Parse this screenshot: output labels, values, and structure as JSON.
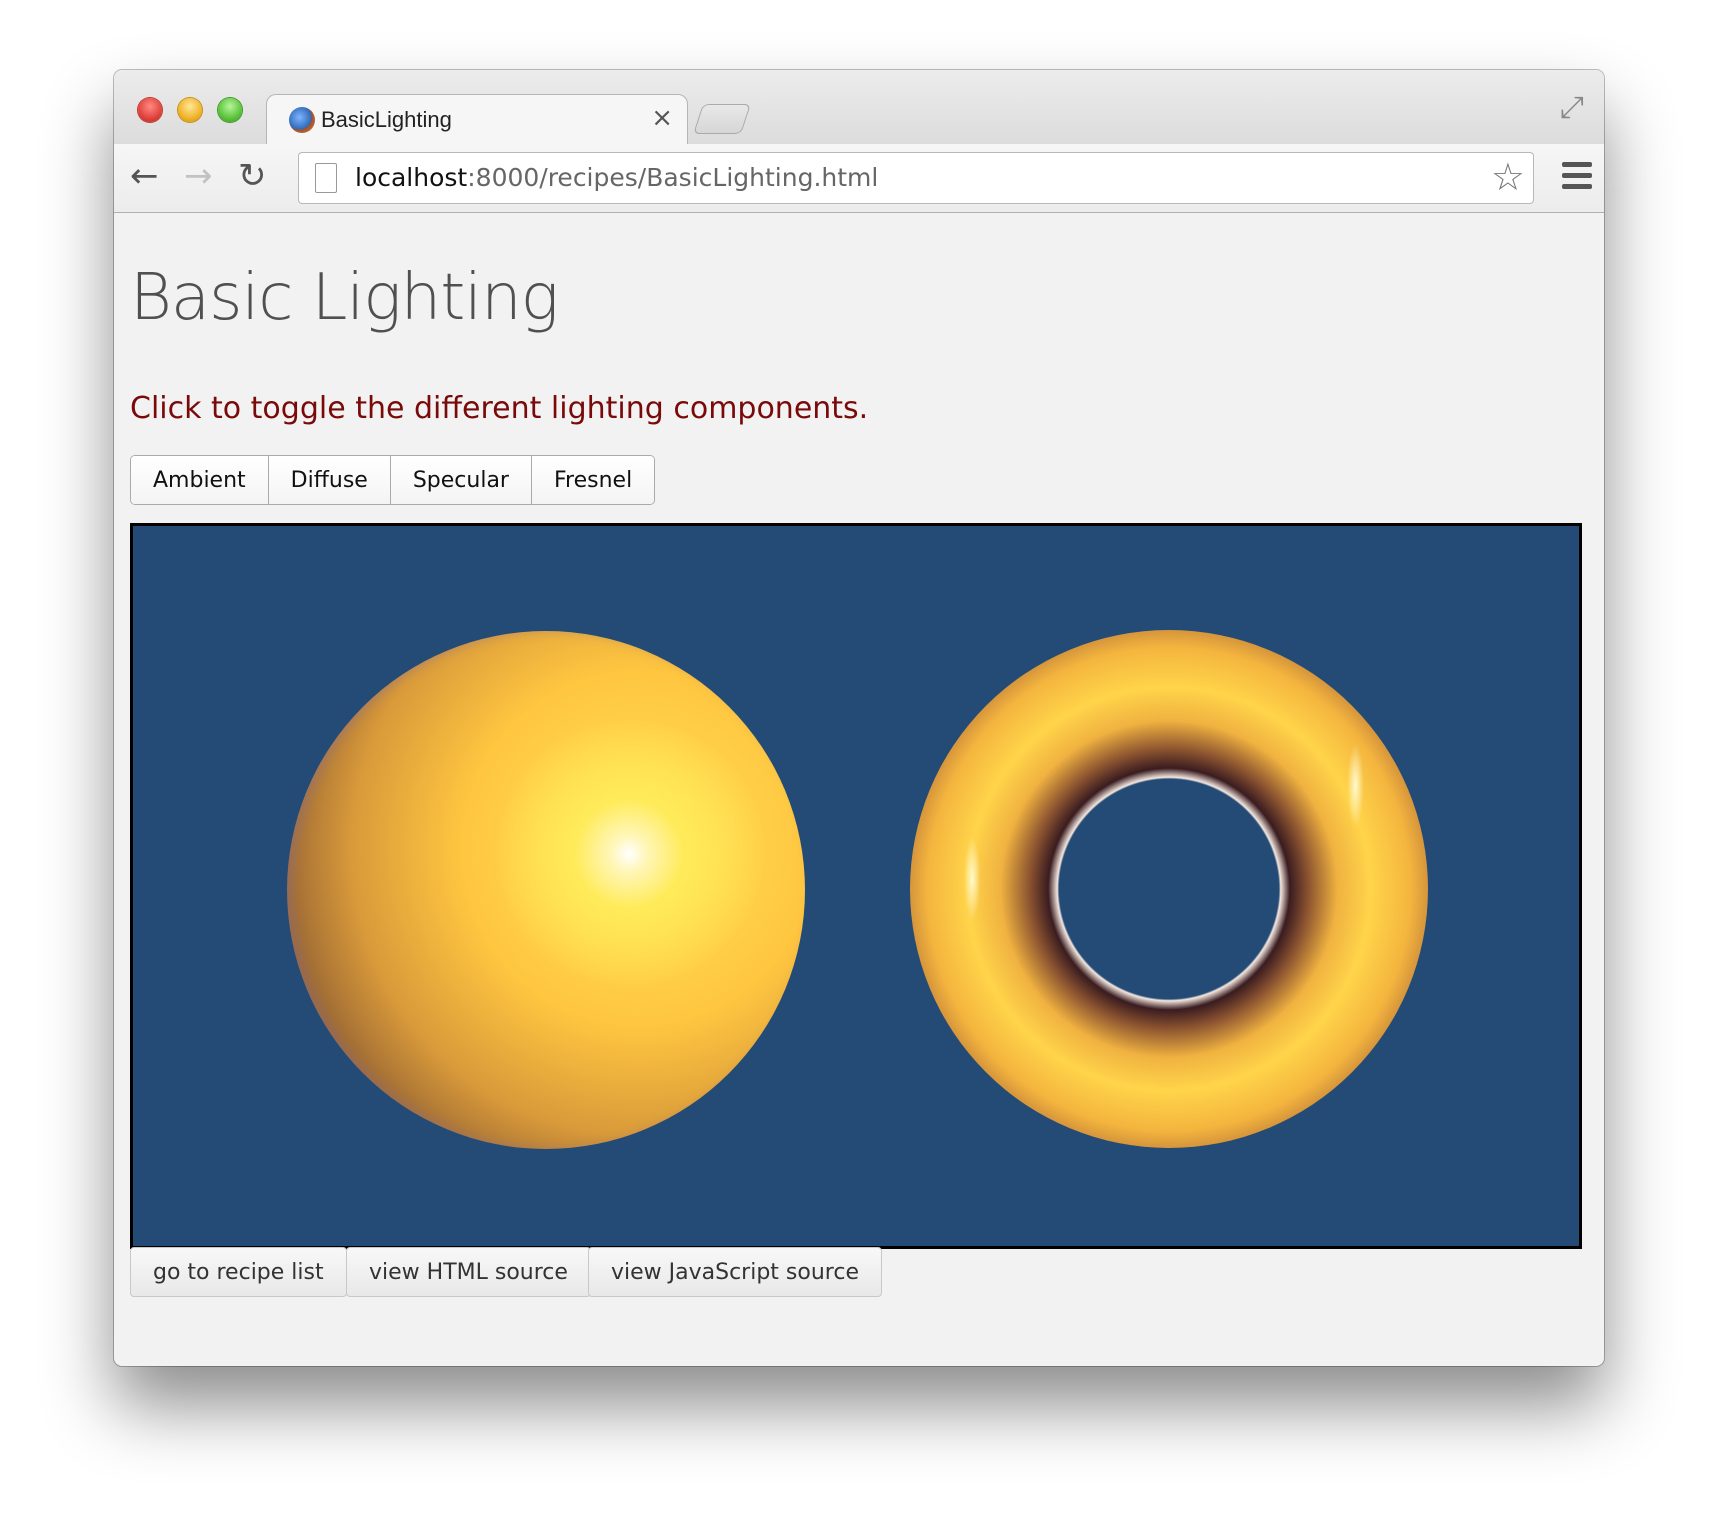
{
  "browser": {
    "tab_title": "BasicLighting",
    "tab_close": "×",
    "url_host": "localhost",
    "url_rest": ":8000/recipes/BasicLighting.html",
    "icons": [
      "close-window-icon",
      "minimize-window-icon",
      "zoom-window-icon",
      "favicon-icon",
      "tab-close-icon",
      "fullscreen-icon",
      "back-icon",
      "forward-icon",
      "reload-icon",
      "page-icon",
      "bookmark-star-icon",
      "menu-icon"
    ]
  },
  "page": {
    "title": "Basic Lighting",
    "instructions": "Click to toggle the different lighting components.",
    "toggles": [
      {
        "label": "Ambient"
      },
      {
        "label": "Diffuse"
      },
      {
        "label": "Specular"
      },
      {
        "label": "Fresnel"
      }
    ],
    "canvas_background": "#234b76",
    "object_color": "#ffc640",
    "nav_buttons": [
      {
        "label": "go to recipe list"
      },
      {
        "label": "view HTML source"
      },
      {
        "label": "view JavaScript source"
      }
    ]
  }
}
